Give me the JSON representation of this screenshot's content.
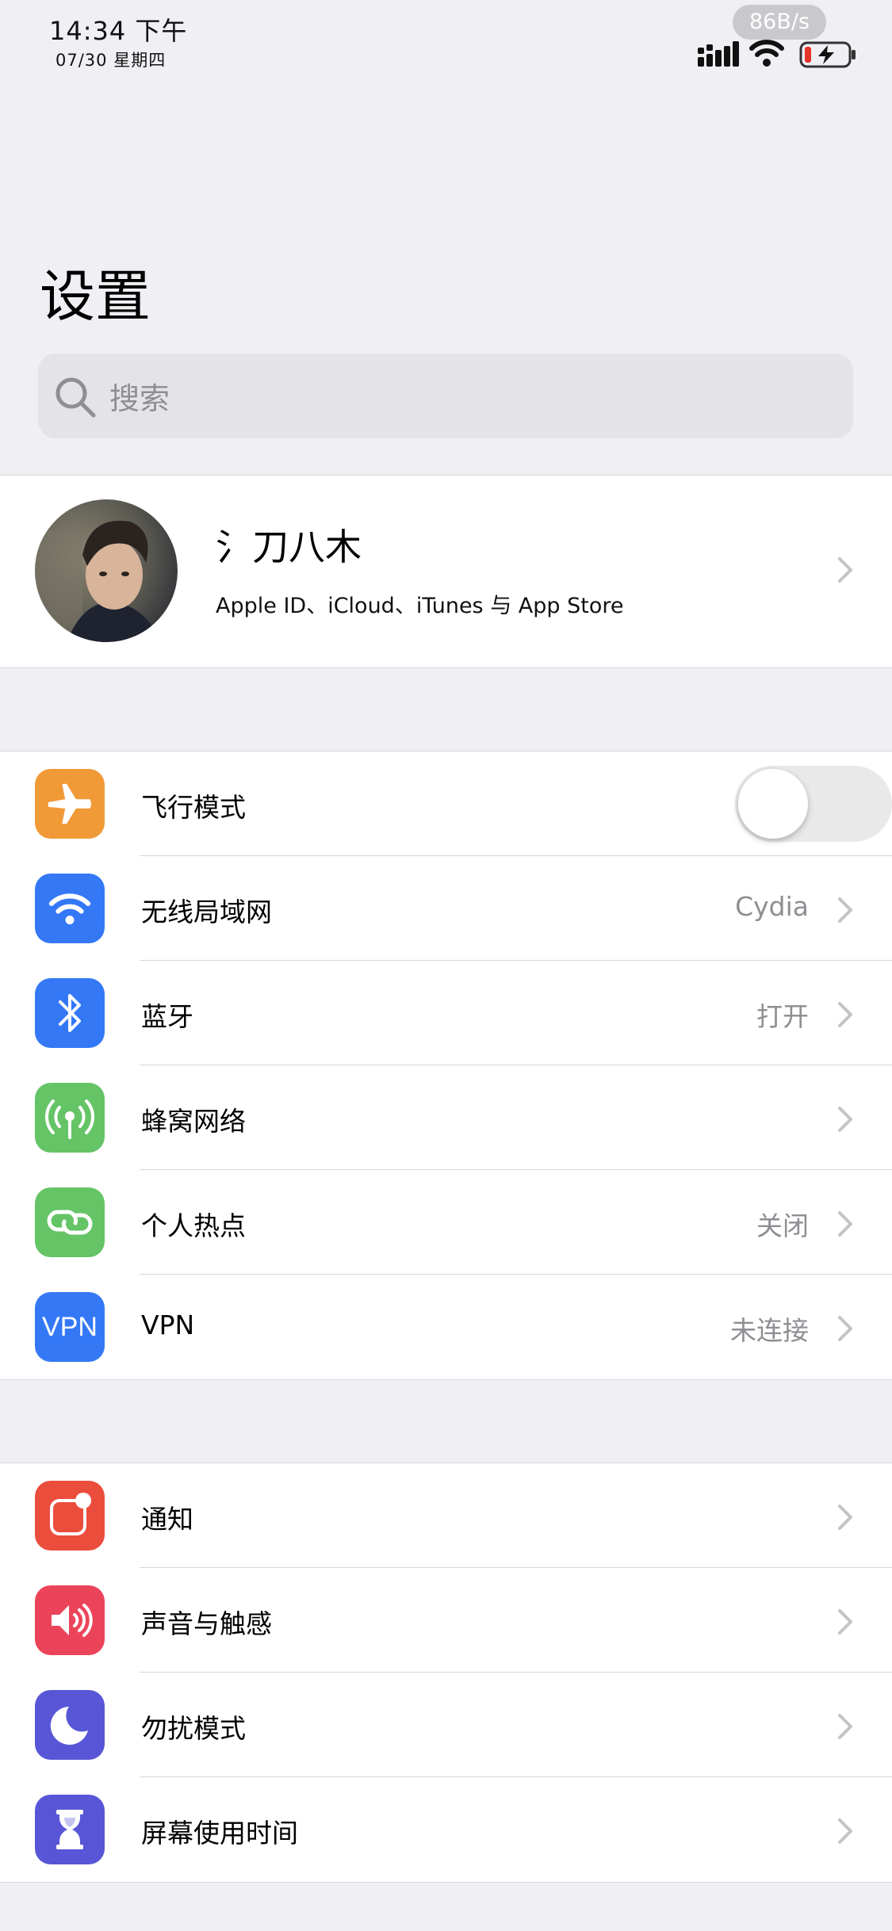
{
  "status_bar": {
    "time": "14:34 下午",
    "date": "07/30 星期四",
    "net_speed": "86B/s",
    "icons": [
      "signal-icon",
      "wifi-icon",
      "battery-charging-icon"
    ]
  },
  "page": {
    "title": "设置"
  },
  "search": {
    "placeholder": "搜索"
  },
  "profile": {
    "name": "氵刀八木",
    "subtitle": "Apple ID、iCloud、iTunes 与 App Store"
  },
  "connectivity": [
    {
      "label": "飞行模式",
      "icon": "airplane-icon",
      "color": "#f09a37",
      "control": "toggle",
      "toggle_on": false
    },
    {
      "label": "无线局域网",
      "icon": "wifi-icon",
      "color": "#3478f6",
      "value": "Cydia"
    },
    {
      "label": "蓝牙",
      "icon": "bluetooth-icon",
      "color": "#3478f6",
      "value": "打开"
    },
    {
      "label": "蜂窝网络",
      "icon": "cellular-antenna-icon",
      "color": "#65c466"
    },
    {
      "label": "个人热点",
      "icon": "personal-hotspot-icon",
      "color": "#65c466",
      "value": "关闭"
    },
    {
      "label": "VPN",
      "icon": "vpn-icon",
      "icon_text": "VPN",
      "color": "#3478f6",
      "value": "未连接"
    }
  ],
  "system": [
    {
      "label": "通知",
      "icon": "notifications-icon",
      "color": "#eb4d3d"
    },
    {
      "label": "声音与触感",
      "icon": "sound-icon",
      "color": "#eb445a"
    },
    {
      "label": "勿扰模式",
      "icon": "moon-icon",
      "color": "#5856d6"
    },
    {
      "label": "屏幕使用时间",
      "icon": "hourglass-icon",
      "color": "#5856d6"
    }
  ]
}
